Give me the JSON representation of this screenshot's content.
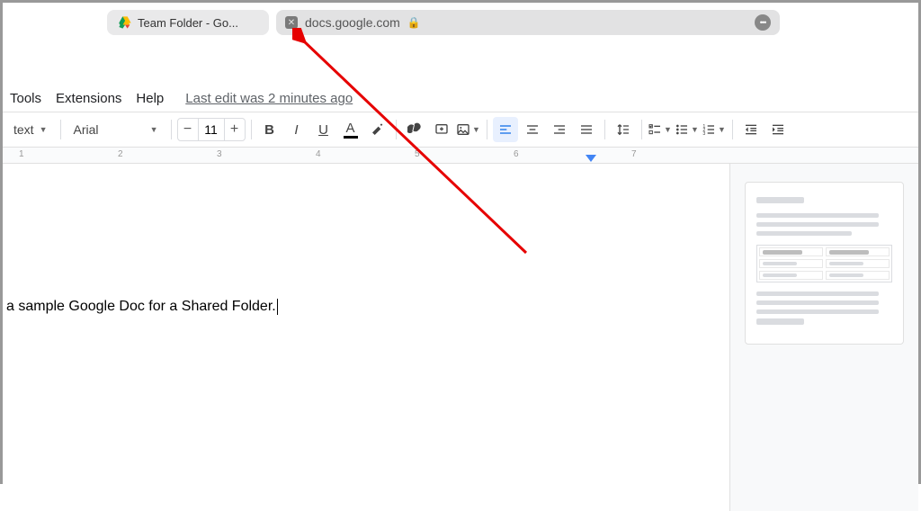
{
  "browser": {
    "tab_label": "Team Folder - Go...",
    "address": "docs.google.com"
  },
  "menubar": {
    "items": [
      "Tools",
      "Extensions",
      "Help"
    ],
    "last_edit": "Last edit was 2 minutes ago"
  },
  "toolbar": {
    "style": "text",
    "font": "Arial",
    "font_size": "11"
  },
  "ruler": {
    "marks": [
      "1",
      "2",
      "3",
      "4",
      "5",
      "6",
      "7"
    ]
  },
  "document": {
    "body_text": "a sample Google Doc for a Shared Folder."
  }
}
